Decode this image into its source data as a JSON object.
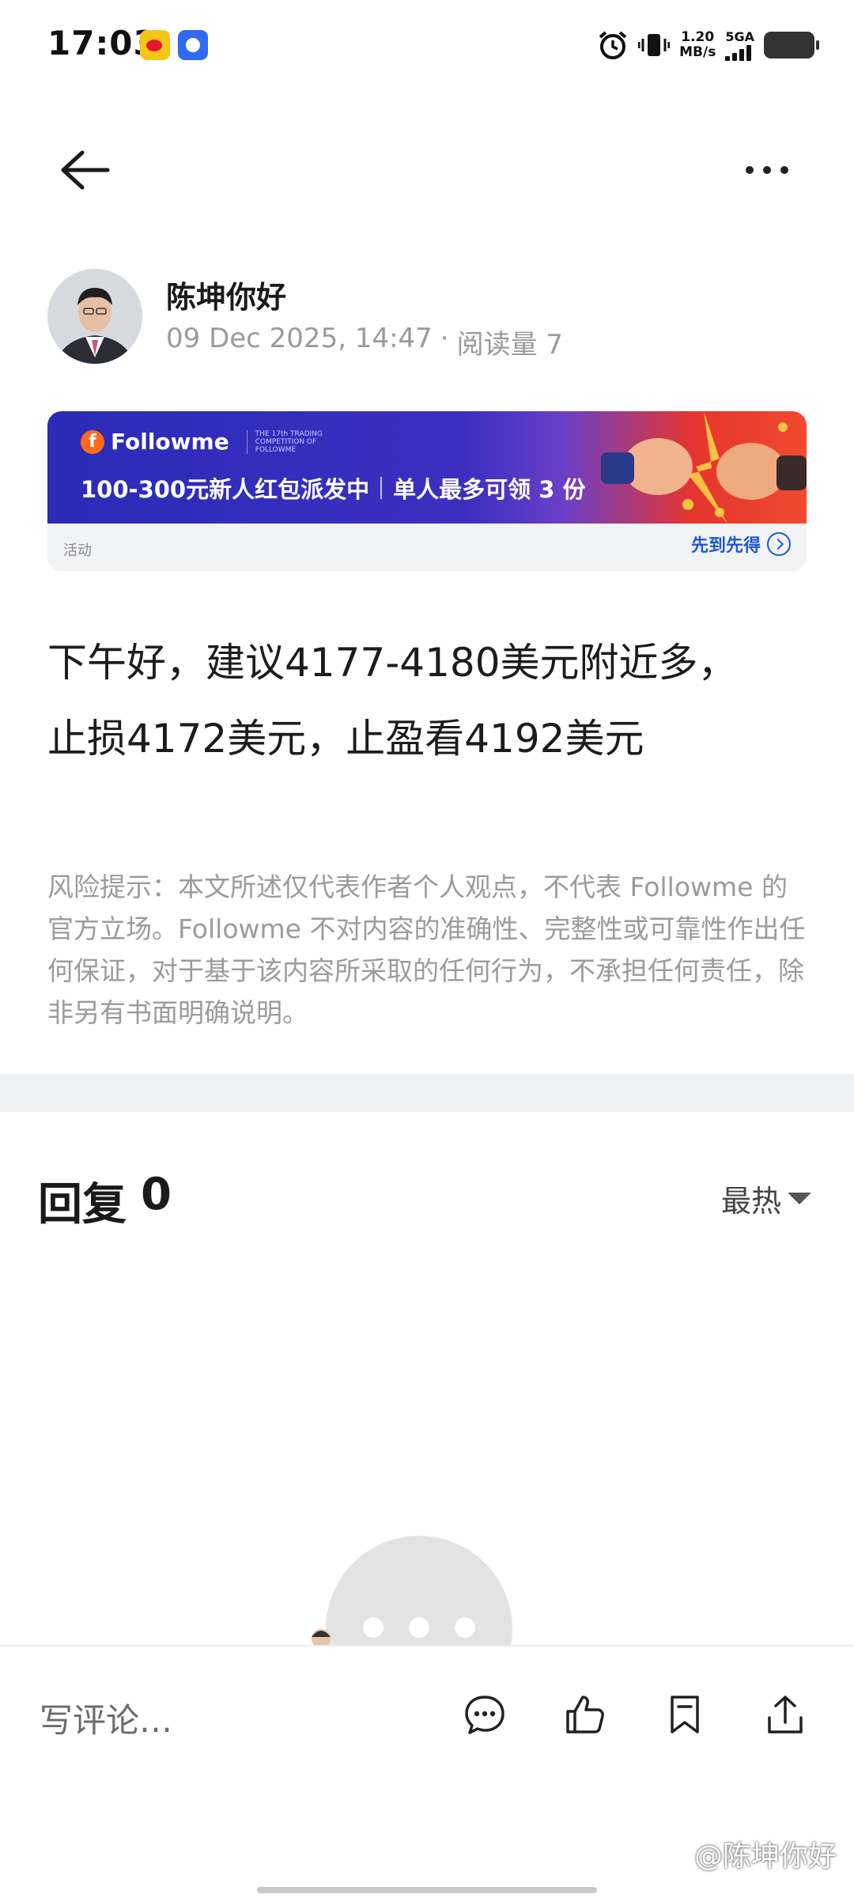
{
  "status_bar": {
    "time": "17:03",
    "net_speed_value": "1.20",
    "net_speed_unit": "MB/s",
    "network": "5GA",
    "apps": [
      "weibo-icon",
      "baidu-icon"
    ]
  },
  "header": {
    "back_icon": "back-arrow-icon",
    "more_icon": "more-icon"
  },
  "author": {
    "name": "陈坤你好",
    "date": "09 Dec 2025, 14:47",
    "separator": "·",
    "views": "阅读量 7"
  },
  "banner": {
    "logo_text": "Followme",
    "logo_sub": "THE 17th TRADING COMPETITION OF FOLLOWME",
    "headline_left": "100-300元新人红包派发中",
    "headline_right": "单人最多可领 3 份",
    "tag": "活动",
    "cta": "先到先得",
    "colors": {
      "bg_start": "#2b2bb8",
      "bg_end": "#f04a2f",
      "cta": "#1f57d6"
    }
  },
  "post": {
    "line1": "下午好，建议4177-4180美元附近多，",
    "line2": "止损4172美元，止盈看4192美元"
  },
  "disclaimer": "风险提示：本文所述仅代表作者个人观点，不代表 Followme 的官方立场。Followme 不对内容的准确性、完整性或可靠性作出任何保证，对于基于该内容所采取的任何行为，不承担任何责任，除非另有书面明确说明。",
  "replies": {
    "label": "回复",
    "count": "0",
    "sort": "最热"
  },
  "bottom_bar": {
    "comment_placeholder": "写评论…",
    "icons": [
      "comment-icon",
      "like-icon",
      "bookmark-icon",
      "share-icon"
    ]
  },
  "watermark": "@陈坤你好"
}
